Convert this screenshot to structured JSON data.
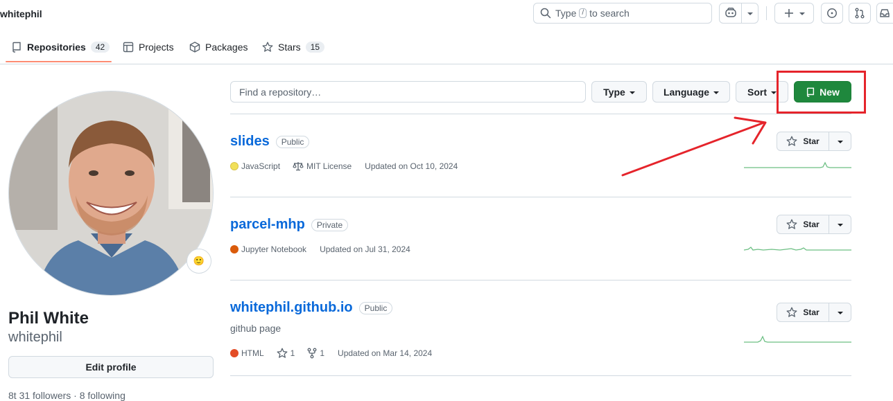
{
  "header": {
    "username": "whitephil",
    "search": {
      "prefix": "Type",
      "key": "/",
      "suffix": "to search"
    }
  },
  "tabs": [
    {
      "label": "Repositories",
      "count": "42",
      "icon": "repo-icon"
    },
    {
      "label": "Projects",
      "icon": "table-icon"
    },
    {
      "label": "Packages",
      "icon": "package-icon"
    },
    {
      "label": "Stars",
      "count": "15",
      "icon": "star-icon"
    }
  ],
  "profile": {
    "full_name": "Phil White",
    "login": "whitephil",
    "edit_label": "Edit profile",
    "status_emoji": "🙂",
    "followers_line": "8t 31 followers · 8 following"
  },
  "filters": {
    "placeholder": "Find a repository…",
    "type_label": "Type",
    "language_label": "Language",
    "sort_label": "Sort",
    "new_label": "New"
  },
  "repos": [
    {
      "name": "slides",
      "visibility": "Public",
      "language": "JavaScript",
      "language_color": "#f1e05a",
      "license": "MIT License",
      "updated": "Updated on Oct 10, 2024",
      "star_label": "Star"
    },
    {
      "name": "parcel-mhp",
      "visibility": "Private",
      "language": "Jupyter Notebook",
      "language_color": "#DA5B0B",
      "updated": "Updated on Jul 31, 2024",
      "star_label": "Star"
    },
    {
      "name": "whitephil.github.io",
      "visibility": "Public",
      "description": "github page",
      "language": "HTML",
      "language_color": "#e34c26",
      "stars": "1",
      "forks": "1",
      "updated": "Updated on Mar 14, 2024",
      "star_label": "Star"
    }
  ],
  "colors": {
    "accent_green": "#1f883d",
    "link_blue": "#0969da",
    "annotation_red": "#e5242b",
    "tab_underline": "#fd8c73",
    "sparkline": "#2da44e"
  }
}
